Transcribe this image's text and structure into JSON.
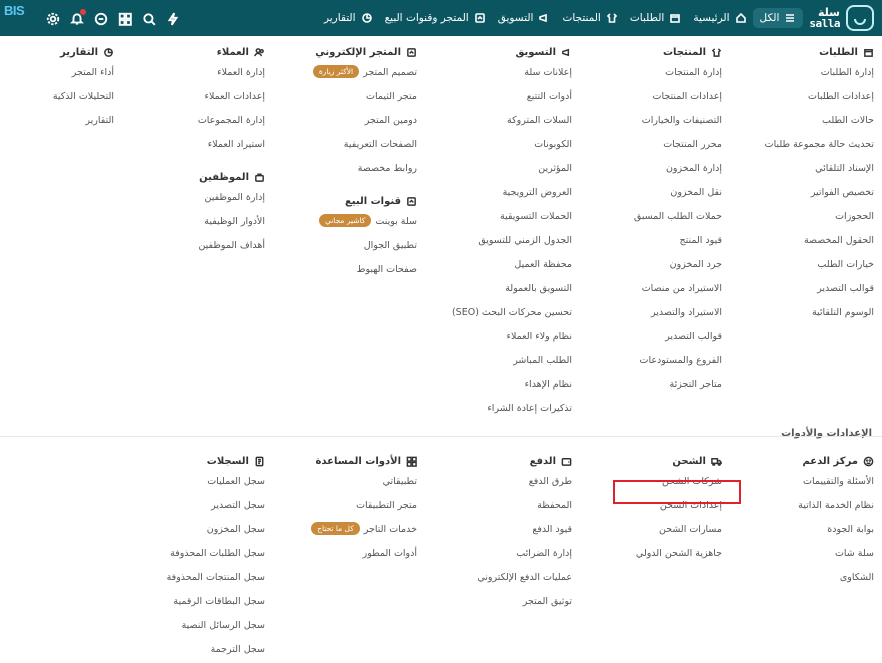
{
  "app": {
    "brand_ar": "سلة",
    "brand_en": "salla",
    "bis_logo": "BIS"
  },
  "nav": [
    {
      "label": "الكل",
      "icon": "menu-icon"
    },
    {
      "label": "الرئيسية",
      "icon": "home-icon"
    },
    {
      "label": "الطلبات",
      "icon": "box-icon"
    },
    {
      "label": "المنتجات",
      "icon": "shirt-icon"
    },
    {
      "label": "التسويق",
      "icon": "megaphone-icon"
    },
    {
      "label": "المتجر وقنوات البيع",
      "icon": "store-icon"
    },
    {
      "label": "التقارير",
      "icon": "chart-icon"
    }
  ],
  "tools": [
    "lightning-icon",
    "search-icon",
    "grid-icon",
    "chat-icon",
    "bell-icon",
    "gear-icon"
  ],
  "menu": {
    "orders": {
      "title": "الطلبات",
      "items": [
        "إدارة الطلبات",
        "إعدادات الطلبات",
        "حالات الطلب",
        "تحديث حالة مجموعة طلبات",
        "الإسناد التلقائي",
        "تخصيص الفواتير",
        "الحجوزات",
        "الحقول المخصصة",
        "خيارات الطلب",
        "قوالب التصدير",
        "الوسوم التلقائية"
      ]
    },
    "products": {
      "title": "المنتجات",
      "items": [
        "إدارة المنتجات",
        "إعدادات المنتجات",
        "التصنيفات والخيارات",
        "محرر المنتجات",
        "إدارة المخزون",
        "نقل المخزون",
        "حملات الطلب المسبق",
        "قيود المنتج",
        "جرد المخزون",
        "الاستيراد من منصات",
        "الاستيراد والتصدير",
        "قوالب التصدير",
        "الفروع والمستودعات",
        "متاجر التجزئة"
      ]
    },
    "marketing": {
      "title": "التسويق",
      "items": [
        "إعلانات سلة",
        "أدوات التتبع",
        "السلات المتروكة",
        "الكوبونات",
        "المؤثرين",
        "العروض الترويجية",
        "الحملات التسويقية",
        "الجدول الزمني للتسويق",
        "محفظة العميل",
        "التسويق بالعمولة",
        "تحسين محركات البحث (SEO)",
        "نظام ولاء العملاء",
        "الطلب المباشر",
        "نظام الإهداء",
        "تذكيرات إعادة الشراء"
      ]
    },
    "store": {
      "title": "المتجر الإلكتروني",
      "items": [
        "تصميم المتجر",
        "متجر الثيمات",
        "دومين المتجر",
        "الصفحات التعريفية",
        "روابط مخصصة"
      ],
      "badge": "الأكثر زيارة"
    },
    "channels": {
      "title": "قنوات البيع",
      "items": [
        "سلة بوينت",
        "تطبيق الجوال",
        "صفحات الهبوط"
      ],
      "badge": "كاشير مجاني"
    },
    "customers": {
      "title": "العملاء",
      "items": [
        "إدارة العملاء",
        "إعدادات العملاء",
        "إدارة المجموعات",
        "استيراد العملاء"
      ]
    },
    "employees": {
      "title": "الموظفين",
      "items": [
        "إدارة الموظفين",
        "الأدوار الوظيفية",
        "أهداف الموظفين"
      ]
    },
    "reports": {
      "title": "التقارير",
      "items": [
        "أداء المتجر",
        "التحليلات الذكية",
        "التقارير"
      ]
    }
  },
  "settings": {
    "heading": "الإعدادات والأدوات",
    "support": {
      "title": "مركز الدعم",
      "items": [
        "الأسئلة والتقييمات",
        "نظام الخدمة الذاتية",
        "بوابة الجودة",
        "سلة شات",
        "الشكاوى"
      ]
    },
    "shipping": {
      "title": "الشحن",
      "items": [
        "شركات الشحن",
        "إعدادات الشحن",
        "مسارات الشحن",
        "جاهزية الشحن الدولي"
      ]
    },
    "payment": {
      "title": "الدفع",
      "items": [
        "طرق الدفع",
        "المحفظة",
        "قيود الدفع",
        "إدارة الضرائب",
        "عمليات الدفع الإلكتروني",
        "توثيق المتجر"
      ]
    },
    "tools": {
      "title": "الأدوات المساعدة",
      "items": [
        "تطبيقاتي",
        "متجر التطبيقات",
        "خدمات التاجر",
        "أدوات المطور"
      ],
      "badge": "كل ما تحتاج"
    },
    "logs": {
      "title": "السجلات",
      "items": [
        "سجل العمليات",
        "سجل التصدير",
        "سجل المخزون",
        "سجل الطلبات المحذوفة",
        "سجل المنتجات المحذوفة",
        "سجل البطاقات الرقمية",
        "سجل الرسائل النصية",
        "سجل الترجمة"
      ]
    }
  },
  "highlight_target": "شركات الشحن",
  "colors": {
    "topbar": "#0b5561",
    "badge": "#c98a3c",
    "highlight": "#e0202a"
  }
}
